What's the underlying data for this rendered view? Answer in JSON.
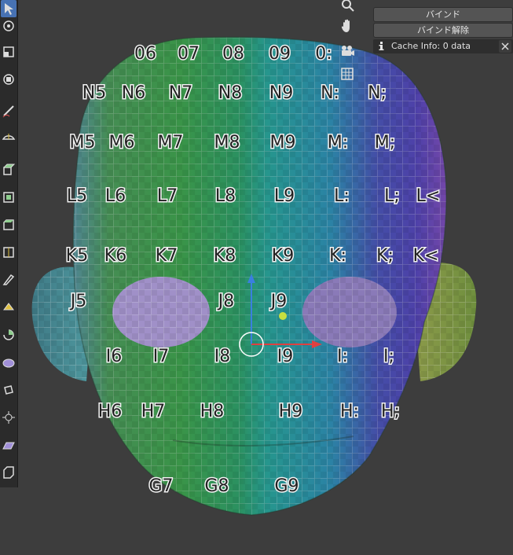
{
  "panel": {
    "bind_label": "バインド",
    "unbind_label": "バインド解除",
    "cache_info": "Cache Info: 0 data"
  },
  "toolbar": {
    "tools": [
      {
        "icon": "cursor-icon",
        "active": true
      },
      {
        "icon": "move-icon"
      },
      {
        "icon": "scale-icon"
      },
      {
        "icon": "transform-icon"
      },
      {
        "icon": "annotate-icon"
      },
      {
        "icon": "measure-icon"
      },
      {
        "icon": "extrude-region-icon"
      },
      {
        "icon": "inset-faces-icon"
      },
      {
        "icon": "bevel-icon"
      },
      {
        "icon": "loop-cut-icon"
      },
      {
        "icon": "knife-icon"
      },
      {
        "icon": "poly-build-icon"
      },
      {
        "icon": "spin-icon"
      },
      {
        "icon": "smooth-icon"
      },
      {
        "icon": "edge-slide-icon"
      },
      {
        "icon": "shrink-fatten-icon"
      },
      {
        "icon": "shear-icon"
      },
      {
        "icon": "rip-region-icon"
      }
    ]
  },
  "navigation": {
    "icons": [
      "zoom-icon",
      "hand-pan-icon",
      "camera-icon",
      "grid-ortho-icon"
    ]
  },
  "mesh_labels": {
    "row_O": [
      "06",
      "07",
      "08",
      "09",
      "0:"
    ],
    "row_N": [
      "N5",
      "N6",
      "N7",
      "N8",
      "N9",
      "N:",
      "N;"
    ],
    "row_M": [
      "M5",
      "M6",
      "M7",
      "M8",
      "M9",
      "M:",
      "M;"
    ],
    "row_L": [
      "L5",
      "L6",
      "L7",
      "L8",
      "L9",
      "L:",
      "L;",
      "L<"
    ],
    "row_K": [
      "K5",
      "K6",
      "K7",
      "K8",
      "K9",
      "K:",
      "K;",
      "K<"
    ],
    "row_J": [
      "J5",
      "J8",
      "J9"
    ],
    "row_I": [
      "I6",
      "I7",
      "I8",
      "I9",
      "I:",
      "I;"
    ],
    "row_H": [
      "H6",
      "H7",
      "H8",
      "H9",
      "H:",
      "H;"
    ],
    "row_G": [
      "G7",
      "G8",
      "G9"
    ]
  },
  "colors": {
    "background": "#3d3d3d",
    "toolbar_bg": "#2b2b2b",
    "active_tool": "#4772b3",
    "button_bg": "#545454",
    "mesh_green": "#3aa35a",
    "mesh_teal": "#2fa3a0",
    "mesh_blue": "#3f4fb8"
  }
}
